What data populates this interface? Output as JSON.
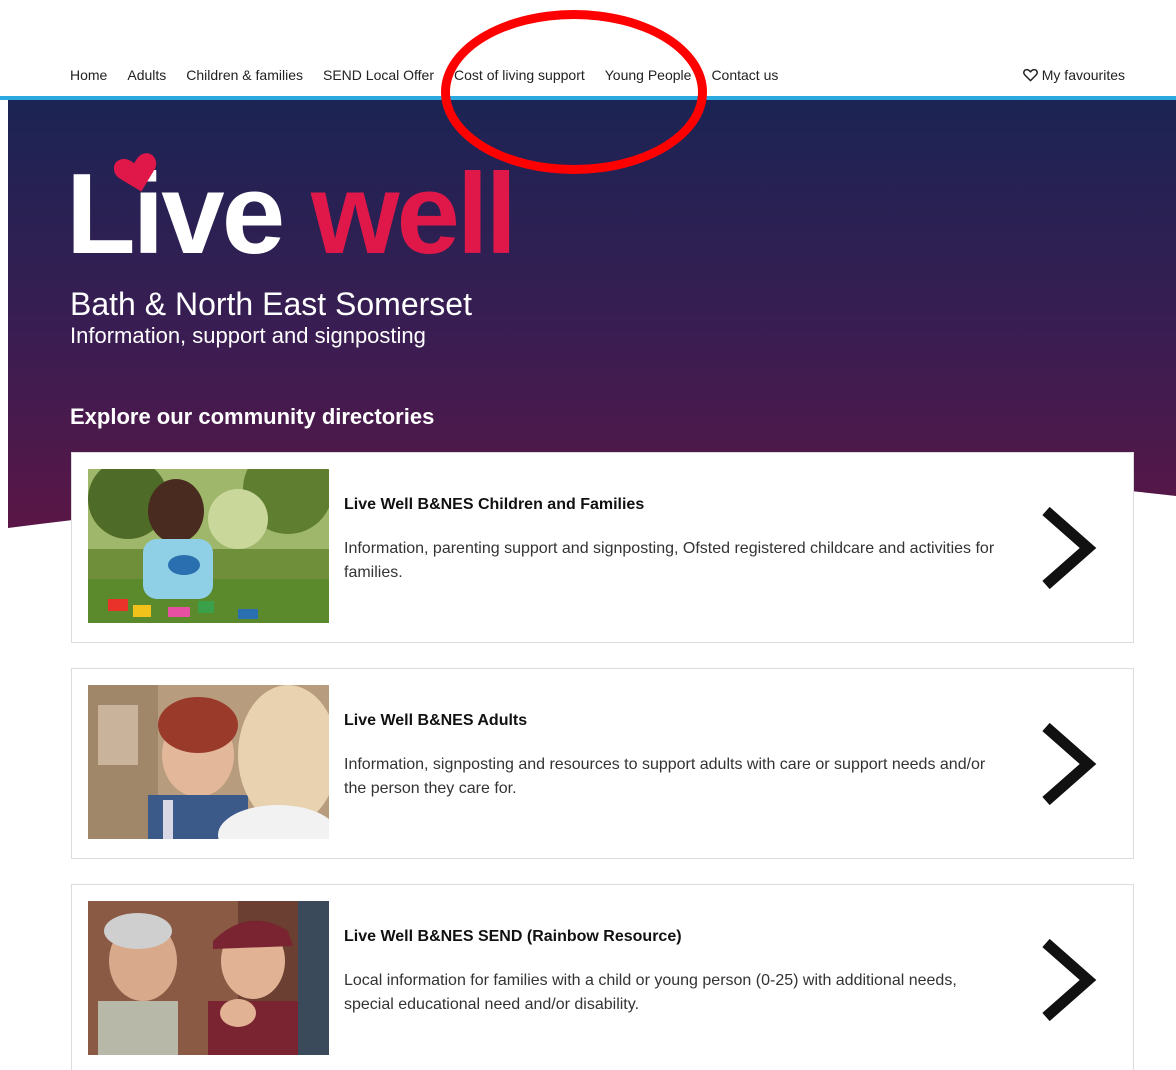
{
  "nav": {
    "links": [
      "Home",
      "Adults",
      "Children & families",
      "SEND Local Offer",
      "Cost of living support",
      "Young People",
      "Contact us"
    ],
    "favourites": "My favourites"
  },
  "hero": {
    "logo_live": "Live",
    "logo_well": "well",
    "region": "Bath & North East Somerset",
    "tagline": "Information, support and signposting",
    "explore_heading": "Explore our community directories"
  },
  "cards": [
    {
      "title": "Live Well B&NES Children and Families",
      "description": "Information, parenting support and signposting, Ofsted registered childcare and activities for families.",
      "image": "toddler-in-garden-photo"
    },
    {
      "title": "Live Well B&NES Adults",
      "description": "Information, signposting and resources to support adults with care or support needs and/or the person they care for.",
      "image": "two-women-talking-photo"
    },
    {
      "title": "Live Well B&NES SEND (Rainbow Resource)",
      "description": "Local information for families with a child or young person (0-25) with additional needs, special educational need and/or disability.",
      "image": "two-men-laughing-photo"
    }
  ],
  "colors": {
    "accent_blue": "#2aa8e0",
    "hero_top": "#1b2454",
    "hero_bottom": "#5a1646",
    "brand_pink": "#e0184a",
    "annotation_red": "#ff0000"
  }
}
